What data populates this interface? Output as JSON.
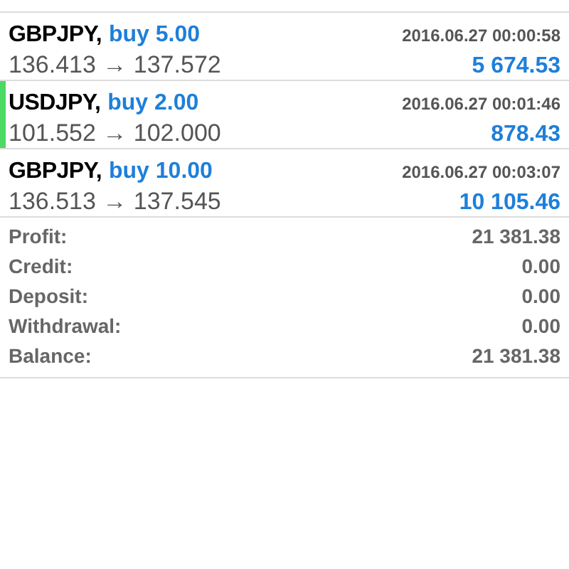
{
  "deals": [
    {
      "symbol": "GBPJPY,",
      "action": "buy 5.00",
      "time": "2016.06.27 00:00:58",
      "prices": "136.413 → 137.572",
      "profit": "5 674.53",
      "selected": false
    },
    {
      "symbol": "USDJPY,",
      "action": "buy 2.00",
      "time": "2016.06.27 00:01:46",
      "prices": "101.552 → 102.000",
      "profit": "878.43",
      "selected": true
    },
    {
      "symbol": "GBPJPY,",
      "action": "buy 10.00",
      "time": "2016.06.27 00:03:07",
      "prices": "136.513 → 137.545",
      "profit": "10 105.46",
      "selected": false
    }
  ],
  "summary": [
    {
      "label": "Profit:",
      "value": "21 381.38"
    },
    {
      "label": "Credit:",
      "value": "0.00"
    },
    {
      "label": "Deposit:",
      "value": "0.00"
    },
    {
      "label": "Withdrawal:",
      "value": "0.00"
    },
    {
      "label": "Balance:",
      "value": "21 381.38"
    }
  ]
}
